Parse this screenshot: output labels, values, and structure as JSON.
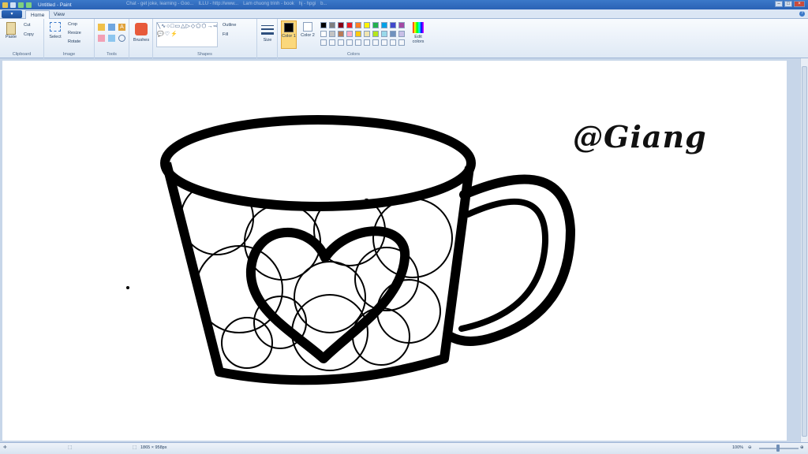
{
  "window": {
    "title": "Untitled - Paint",
    "background_tabs": [
      "Chat - get joke, learning - Goo...",
      "ILLU - http://www...",
      "Lam chuong trinh - book",
      "hj - hpgi",
      "b..."
    ]
  },
  "tabs": {
    "app_menu": "▾",
    "home": "Home",
    "view": "View"
  },
  "ribbon": {
    "clipboard": {
      "label": "Clipboard",
      "paste": "Paste",
      "cut": "Cut",
      "copy": "Copy"
    },
    "image": {
      "label": "Image",
      "select": "Select",
      "crop": "Crop",
      "resize": "Resize",
      "rotate": "Rotate"
    },
    "tools": {
      "label": "Tools"
    },
    "brushes": {
      "label": "Brushes"
    },
    "shapes": {
      "label": "Shapes",
      "outline": "Outline",
      "fill": "Fill"
    },
    "size": {
      "label": "Size"
    },
    "colors": {
      "label": "Colors",
      "color1": "Color 1",
      "color2": "Color 2",
      "edit": "Edit colors",
      "palette_row1": [
        "#000000",
        "#7f7f7f",
        "#880015",
        "#ed1c24",
        "#ff7f27",
        "#fff200",
        "#22b14c",
        "#00a2e8",
        "#3f48cc",
        "#a349a4"
      ],
      "palette_row2": [
        "#ffffff",
        "#c3c3c3",
        "#b97a57",
        "#ffaec9",
        "#ffc90e",
        "#efe4b0",
        "#b5e61d",
        "#99d9ea",
        "#7092be",
        "#c8bfe7"
      ]
    }
  },
  "canvas": {
    "watermark": "@Giang"
  },
  "status": {
    "size": "1865 × 958px",
    "zoom": "100%"
  }
}
